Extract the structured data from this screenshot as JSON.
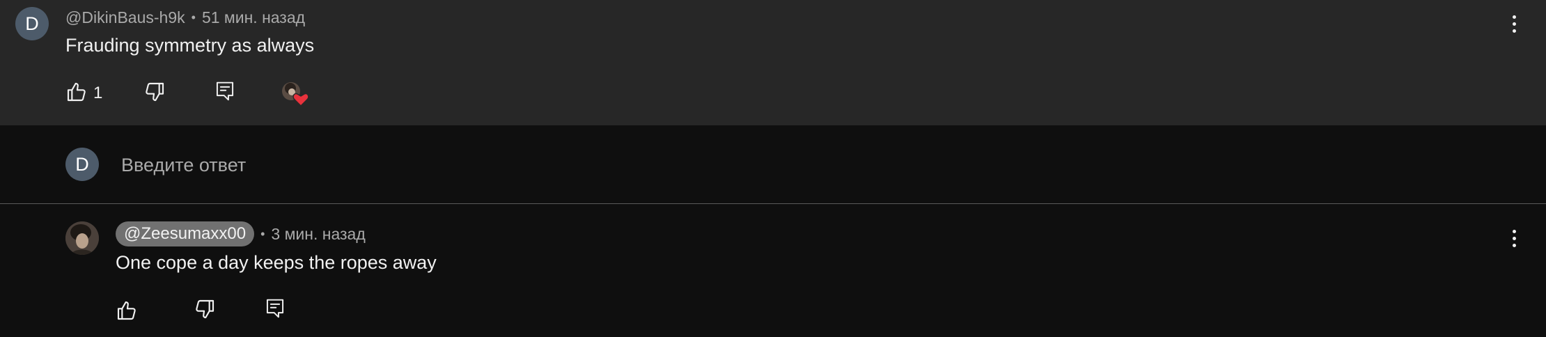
{
  "comment": {
    "avatar_letter": "D",
    "author": "@DikinBaus-h9k",
    "separator": "•",
    "time": "51 мин. назад",
    "text": "Frauding symmetry as always",
    "like_count": "1",
    "icons": [
      "like-icon",
      "dislike-icon",
      "reply-icon",
      "creator-heart-icon",
      "more-icon"
    ]
  },
  "reply_input": {
    "avatar_letter": "D",
    "placeholder": "Введите ответ"
  },
  "reply": {
    "author": "@Zeesumaxx00",
    "separator": "•",
    "time": "3 мин. назад",
    "text": "One cope a day keeps the ropes away",
    "icons": [
      "like-icon",
      "dislike-icon",
      "reply-icon",
      "more-icon"
    ]
  },
  "colors": {
    "comment_bg": "#272727",
    "page_bg": "#0f0f0f",
    "avatar_bg": "#4d5b6a",
    "heart": "#e8323c",
    "mention_chip": "#717171"
  }
}
